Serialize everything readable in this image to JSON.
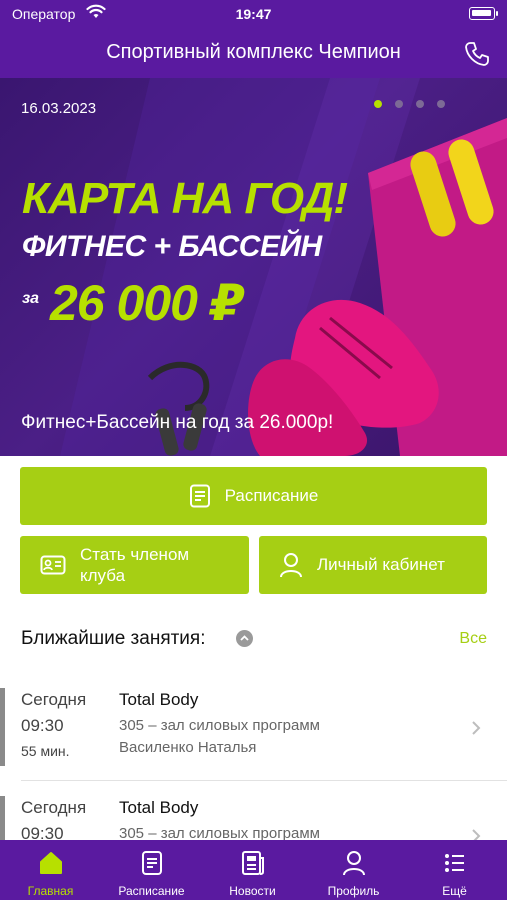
{
  "status_bar": {
    "carrier": "Оператор",
    "time": "19:47"
  },
  "header": {
    "title": "Спортивный комплекс Чемпион",
    "call_icon": "phone-icon"
  },
  "banner": {
    "date": "16.03.2023",
    "headline_1": "КАРТА НА ГОД!",
    "headline_2": "ФИТНЕС + БАССЕЙН",
    "price_prefix": "за",
    "price": "26 000 ₽",
    "caption": "Фитнес+Бассейн на год за 26.000р!",
    "slides_total": 4,
    "slide_active": 1
  },
  "actions": {
    "schedule": {
      "label": "Расписание",
      "icon": "document-icon"
    },
    "membership": {
      "label": "Стать членом клуба",
      "icon": "id-card-icon"
    },
    "cabinet": {
      "label": "Личный кабинет",
      "icon": "person-icon"
    }
  },
  "upcoming": {
    "title": "Ближайшие занятия:",
    "see_all": "Все",
    "lessons": [
      {
        "day": "Сегодня",
        "time": "09:30",
        "duration": "55 мин.",
        "name": "Total Body",
        "room": "305 – зал силовых программ",
        "coach": "Василенко Наталья"
      },
      {
        "day": "Сегодня",
        "time": "09:30",
        "duration": "",
        "name": "Total Body",
        "room": "305 – зал силовых программ",
        "coach": ""
      }
    ]
  },
  "tabbar": {
    "items": [
      {
        "label": "Главная",
        "icon": "home-icon",
        "active": true
      },
      {
        "label": "Расписание",
        "icon": "document-icon",
        "active": false
      },
      {
        "label": "Новости",
        "icon": "news-icon",
        "active": false
      },
      {
        "label": "Профиль",
        "icon": "person-icon",
        "active": false
      },
      {
        "label": "Ещё",
        "icon": "list-icon",
        "active": false
      }
    ]
  },
  "colors": {
    "brand": "#5a1aa0",
    "accent": "#a6cf14",
    "highlight": "#b7e000"
  }
}
